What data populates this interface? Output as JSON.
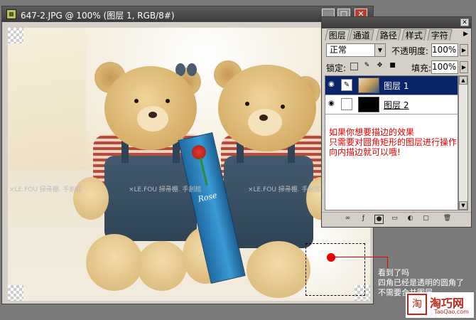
{
  "document": {
    "title": "647-2.JPG @ 100% (图层 1, RGB/8#)",
    "buttons": {
      "minimize": "_",
      "maximize": "□",
      "close": "✕"
    },
    "watermark": "×LE.FOU  掃帚棚. 手創館",
    "photo_box_text": "Rose"
  },
  "layers_panel": {
    "tabs": [
      "图层",
      "通道",
      "路径",
      "样式",
      "字符"
    ],
    "blend_mode": "正常",
    "opacity_label": "不透明度:",
    "opacity_value": "100%",
    "lock_label": "锁定:",
    "fill_label": "填充:",
    "fill_value": "100%",
    "layers": [
      {
        "name": "图层 1",
        "selected": true,
        "visible": true
      },
      {
        "name": "图层 2",
        "selected": false,
        "visible": true
      }
    ],
    "note": [
      "如果你想要描边的效果",
      "只需要对圆角矩形的图层进行操作",
      "向内描边就可以哦!"
    ]
  },
  "callout": [
    "看到了吗",
    "四角已经是透明的圆角了",
    "不需要合并图层"
  ],
  "logo": {
    "seal": "淘",
    "name": "淘巧网",
    "url": "TaoQao.com"
  },
  "icons": {
    "eye": "eye-icon",
    "brush": "brush-icon",
    "link": "link-icon",
    "lock": "lock-icon",
    "move": "move-icon",
    "trash": "trash-icon"
  }
}
